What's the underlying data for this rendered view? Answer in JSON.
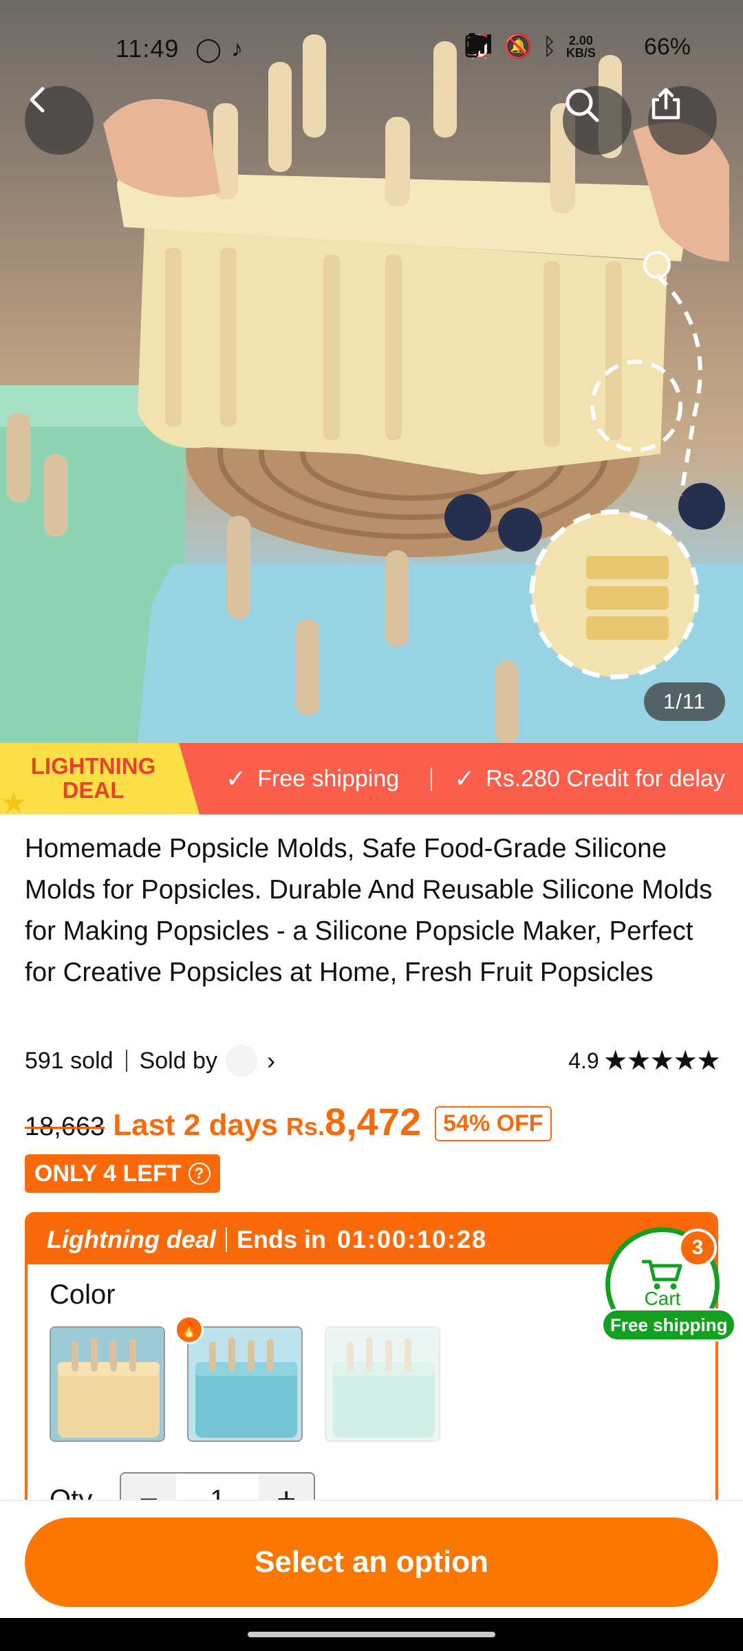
{
  "status_bar": {
    "time": "11:49",
    "net_speed_value": "2.00",
    "net_speed_unit": "KB/S",
    "battery": "66%"
  },
  "hero": {
    "image_counter": "1/11",
    "icons": [
      "back-arrow-icon",
      "search-icon",
      "share-icon"
    ]
  },
  "deal_banner": {
    "tag_line1": "LIGHTNING",
    "tag_line2": "DEAL",
    "perk1": "Free shipping",
    "perk2": "Rs.280 Credit for delay"
  },
  "product": {
    "title": "Homemade Popsicle Molds, Safe Food-Grade Silicone Molds for Popsicles. Durable And Reusable Silicone Molds for Making Popsicles - a Silicone Popsicle Maker, Perfect for Creative Popsicles at Home, Fresh Fruit Popsicles",
    "sold": "591 sold",
    "sold_by": "Sold by",
    "rating": "4.9",
    "stars": "★★★★★"
  },
  "price": {
    "original": "18,663",
    "urgency": "Last 2 days",
    "currency": "Rs.",
    "current": "8,472",
    "discount": "54% OFF",
    "stock": "ONLY 4 LEFT",
    "stock_help": "?"
  },
  "lightning_deal": {
    "title": "Lightning deal",
    "ends_label": "Ends in",
    "timer": "01:00:10:28",
    "color_label": "Color",
    "qty_label": "Qty",
    "qty_minus": "−",
    "qty_value": "1",
    "qty_plus": "+"
  },
  "cart": {
    "label": "Cart",
    "count": "3",
    "shipping": "Free shipping"
  },
  "cta": {
    "label": "Select an option"
  },
  "colors": {
    "accent": "#fb7701",
    "banner": "#fb5e4b",
    "deal_tag": "#fde047",
    "cart_green": "#13a021"
  }
}
